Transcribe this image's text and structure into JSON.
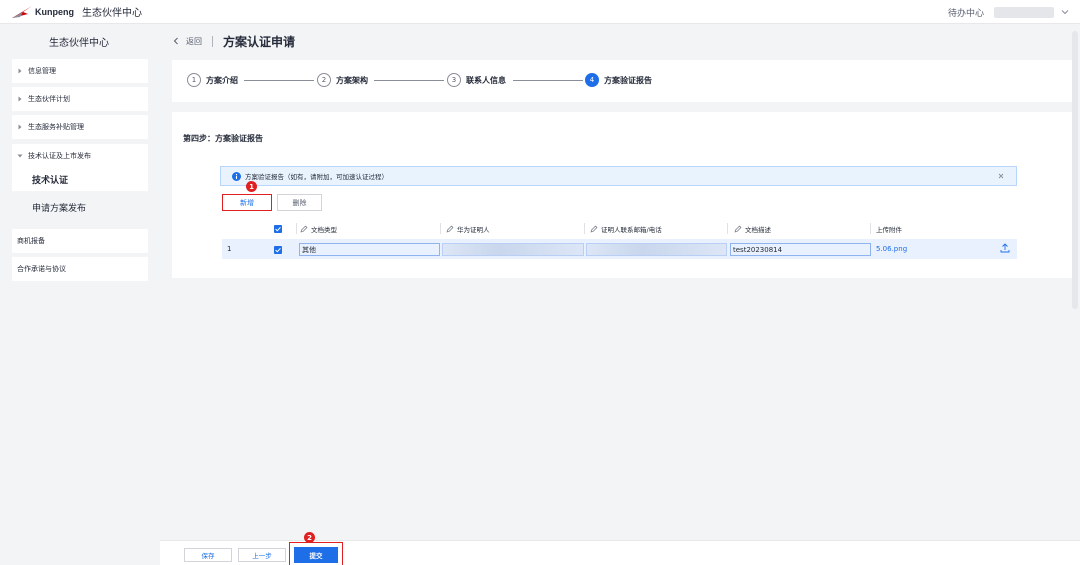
{
  "topbar": {
    "brand": "Kunpeng",
    "title": "生态伙伴中心",
    "todo": "待办中心"
  },
  "sidebar": {
    "title": "生态伙伴中心",
    "items": [
      {
        "label": "信息管理"
      },
      {
        "label": "生态伙伴计划"
      },
      {
        "label": "生态服务补贴管理"
      },
      {
        "label": "技术认证及上市发布"
      },
      {
        "label": "技术认证"
      },
      {
        "label": "申请方案发布"
      },
      {
        "label": "商机报备"
      },
      {
        "label": "合作承诺与协议"
      }
    ]
  },
  "header": {
    "back": "返回",
    "title": "方案认证申请"
  },
  "steps": [
    {
      "num": "1",
      "label": "方案介绍"
    },
    {
      "num": "2",
      "label": "方案架构"
    },
    {
      "num": "3",
      "label": "联系人信息"
    },
    {
      "num": "4",
      "label": "方案验证报告"
    }
  ],
  "content": {
    "section_title": "第四步：方案验证报告",
    "notice": "方案验证报告（如有，请附加，可加速认证过程）",
    "add_button": "新增",
    "delete_button": "删除",
    "columns": [
      "文档类型",
      "华为证明人",
      "证明人联系邮箱/电话",
      "文档描述",
      "上传附件"
    ],
    "row": {
      "index": "1",
      "doc_type": "其他",
      "description": "test20230814",
      "attachment": "5.06.png"
    }
  },
  "annotations": {
    "badge_1": "1",
    "badge_2": "2"
  },
  "footer": {
    "save": "保存",
    "prev": "上一步",
    "submit": "提交"
  },
  "colors": {
    "primary": "#1e6ee8",
    "highlight_red": "#e02020",
    "notice_bg": "#e8f3fe"
  }
}
